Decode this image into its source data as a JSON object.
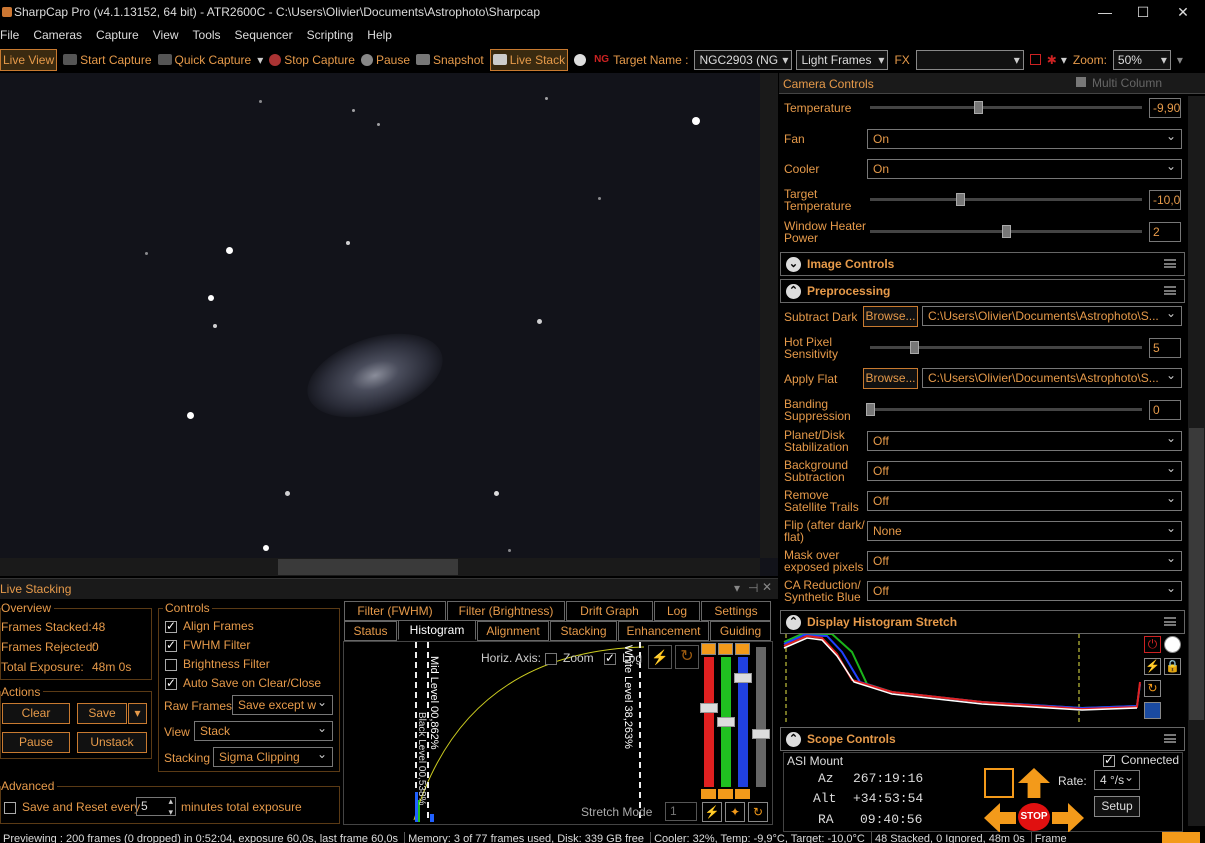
{
  "window": {
    "title": "SharpCap Pro (v4.1.13152, 64 bit) - ATR2600C - C:\\Users\\Olivier\\Documents\\Astrophoto\\Sharpcap",
    "minimize": "—",
    "maximize": "☐",
    "close": "✕"
  },
  "menu": [
    "File",
    "Cameras",
    "Capture",
    "View",
    "Tools",
    "Sequencer",
    "Scripting",
    "Help"
  ],
  "toolbar": {
    "live_view": "Live View",
    "start_capture": "Start Capture",
    "quick_capture": "Quick Capture",
    "stop_capture": "Stop Capture",
    "pause": "Pause",
    "snapshot": "Snapshot",
    "live_stack": "Live Stack",
    "target_label": "Target Name :",
    "target_value": "NGC2903 (NG",
    "frame_type": "Light Frames",
    "fx_label": "FX",
    "zoom_label": "Zoom:",
    "zoom_value": "50%"
  },
  "camera_controls": {
    "title": "Camera Controls",
    "multi_column": "Multi Column",
    "temperature": {
      "label": "Temperature",
      "value": "-9,90"
    },
    "fan": {
      "label": "Fan",
      "value": "On"
    },
    "cooler": {
      "label": "Cooler",
      "value": "On"
    },
    "target_temperature": {
      "label": "Target Temperature",
      "value": "-10,0"
    },
    "window_heater": {
      "label": "Window Heater Power",
      "value": "2"
    }
  },
  "image_controls": {
    "title": "Image Controls"
  },
  "preprocessing": {
    "title": "Preprocessing",
    "browse": "Browse...",
    "subtract_dark": {
      "label": "Subtract Dark",
      "path": "C:\\Users\\Olivier\\Documents\\Astrophoto\\S..."
    },
    "hot_pixel": {
      "label": "Hot Pixel Sensitivity",
      "value": "5"
    },
    "apply_flat": {
      "label": "Apply Flat",
      "path": "C:\\Users\\Olivier\\Documents\\Astrophoto\\S..."
    },
    "banding": {
      "label": "Banding Suppression",
      "value": "0"
    },
    "planet_stab": {
      "label": "Planet/Disk Stabilization",
      "value": "Off"
    },
    "background": {
      "label": "Background Subtraction",
      "value": "Off"
    },
    "satellite": {
      "label": "Remove Satellite Trails",
      "value": "Off"
    },
    "flip": {
      "label": "Flip (after dark/ flat)",
      "value": "None"
    },
    "mask": {
      "label": "Mask over exposed pixels",
      "value": "Off"
    },
    "ca": {
      "label": "CA Reduction/ Synthetic Blue",
      "value": "Off"
    }
  },
  "histogram_stretch": {
    "title": "Display Histogram Stretch"
  },
  "scope": {
    "title": "Scope Controls",
    "mount": "ASI Mount",
    "connected": "Connected",
    "az_label": "Az",
    "az": "267:19:16",
    "alt_label": "Alt",
    "alt": "+34:53:54",
    "ra_label": "RA",
    "ra": "09:40:56",
    "rate_label": "Rate:",
    "rate": "4 °/s",
    "setup": "Setup",
    "stop": "STOP"
  },
  "live_stacking": {
    "title": "Live Stacking",
    "overview": {
      "title": "Overview",
      "stacked_label": "Frames Stacked:",
      "stacked": "48",
      "rejected_label": "Frames Rejected:",
      "rejected": "0",
      "exposure_label": "Total Exposure:",
      "exposure": "48m 0s"
    },
    "actions": {
      "title": "Actions",
      "clear": "Clear",
      "save": "Save",
      "pause": "Pause",
      "unstack": "Unstack"
    },
    "controls": {
      "title": "Controls",
      "align": "Align Frames",
      "fwhm": "FWHM Filter",
      "brightness": "Brightness Filter",
      "autosave": "Auto Save on Clear/Close",
      "raw_label": "Raw Frames",
      "raw_value": "Save except w",
      "view_label": "View",
      "view_value": "Stack",
      "stacking_label": "Stacking",
      "stacking_value": "Sigma Clipping"
    },
    "advanced": {
      "title": "Advanced",
      "save_reset": "Save and Reset every",
      "minutes": "5",
      "suffix": "minutes total exposure"
    },
    "tabs_top": [
      "Filter (FWHM)",
      "Filter (Brightness)",
      "Drift Graph",
      "Log",
      "Settings"
    ],
    "tabs_bottom": [
      "Status",
      "Histogram",
      "Alignment",
      "Stacking",
      "Enhancement",
      "Guiding"
    ],
    "histogram": {
      "horiz_axis": "Horiz. Axis:",
      "zoom": "Zoom",
      "log": "Log",
      "white_level": "White Level  38,263%",
      "mid_level": "Mid Level 00,862%",
      "black_level": "Black Level 00,538%",
      "stretch_mode": "Stretch Mode",
      "stretch_value": "1"
    }
  },
  "status": [
    "Previewing : 200 frames (0 dropped) in 0:52:04, exposure 60,0s, last frame 60,0s",
    "Memory: 3 of 77 frames used, Disk: 339 GB free",
    "Cooler: 32%, Temp: -9,9°C, Target: -10,0°C",
    "48 Stacked, 0 Ignored, 48m 0s",
    "Frame"
  ]
}
